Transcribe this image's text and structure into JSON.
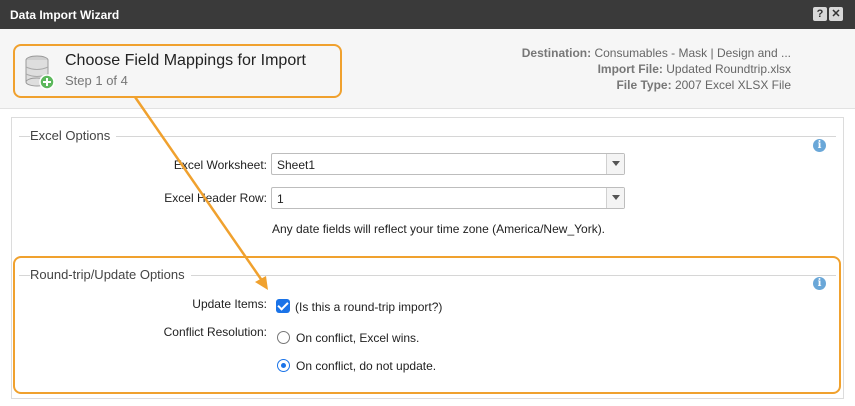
{
  "window": {
    "title": "Data Import Wizard",
    "help_label": "?",
    "close_label": "✕"
  },
  "header": {
    "icon": "database-add-icon",
    "step_title": "Choose Field Mappings for Import",
    "step_sub": "Step 1 of 4",
    "destination_label": "Destination:",
    "destination_value": "Consumables - Mask | Design and ...",
    "import_file_label": "Import File:",
    "import_file_value": "Updated Roundtrip.xlsx",
    "file_type_label": "File Type:",
    "file_type_value": "2007 Excel XLSX File"
  },
  "excel_options": {
    "title": "Excel Options",
    "worksheet_label": "Excel Worksheet:",
    "worksheet_value": "Sheet1",
    "header_row_label": "Excel Header Row:",
    "header_row_value": "1",
    "timezone_note": "Any date fields will reflect your time zone (America/New_York)."
  },
  "roundtrip": {
    "title": "Round-trip/Update Options",
    "update_items_label": "Update Items:",
    "update_items_checked": true,
    "update_items_text": "(Is this a round-trip import?)",
    "conflict_label": "Conflict Resolution:",
    "option_excel_wins": "On conflict, Excel wins.",
    "option_no_update": "On conflict, do not update.",
    "selected_option": "On conflict, do not update."
  },
  "colors": {
    "highlight": "#f0a12e",
    "accent": "#1a73e8",
    "titlebar": "#3a3a3a"
  }
}
